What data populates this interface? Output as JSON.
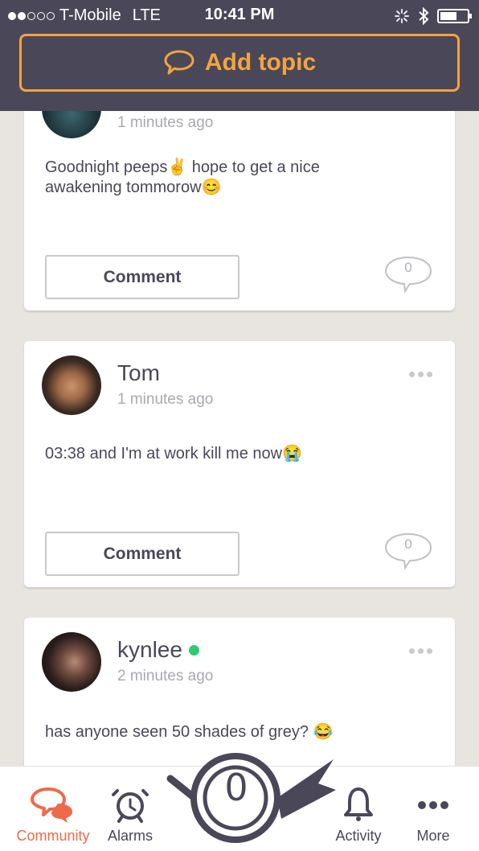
{
  "status_bar": {
    "carrier": "T-Mobile",
    "network": "LTE",
    "time": "10:41 PM",
    "signal_bars": 2,
    "signal_max": 5
  },
  "header": {
    "add_topic_label": "Add topic",
    "accent_color": "#f3a440"
  },
  "posts": [
    {
      "author": "",
      "time_ago": "1 minutes ago",
      "text": "Goodnight peeps✌️ hope to get a nice awakening tommorow😊",
      "comment_label": "Comment",
      "comment_count": "0"
    },
    {
      "author": "Tom",
      "time_ago": "1 minutes ago",
      "text": "03:38 and I'm at work kill me now😭",
      "comment_label": "Comment",
      "comment_count": "0"
    },
    {
      "author": "kynlee",
      "time_ago": "2 minutes ago",
      "text": "has anyone seen 50 shades of grey? 😂",
      "online": true
    }
  ],
  "tabbar": {
    "community": "Community",
    "alarms": "Alarms",
    "center_count": "0",
    "activity": "Activity",
    "more": "More",
    "active_color": "#ef6a4a"
  }
}
